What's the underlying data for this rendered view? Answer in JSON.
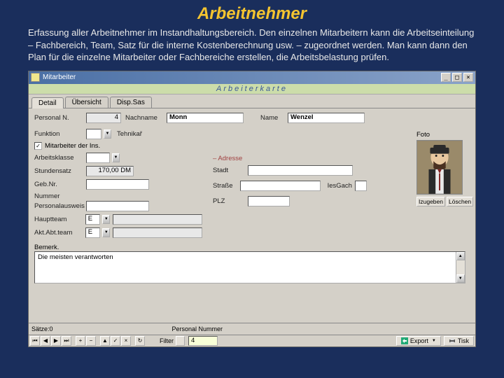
{
  "page": {
    "title": "Arbeitnehmer",
    "description": "Erfassung aller Arbeitnehmer im Instandhaltungsbereich. Den einzelnen Mitarbeitern kann die Arbeitseinteilung – Fachbereich, Team, Satz für die interne Kostenberechnung usw. – zugeordnet werden. Man kann dann den Plan für die einzelne Mitarbeiter oder Fachbereiche erstellen, die Arbeitsbelastung prüfen."
  },
  "window": {
    "title": "Mitarbeiter",
    "card_title": "Arbeiterkarte"
  },
  "tabs": [
    "Detail",
    "Übersicht",
    "Disp.Sas"
  ],
  "fields": {
    "personal_n_label": "Personal N.",
    "personal_n_value": "4",
    "nachname_label": "Nachname",
    "nachname_value": "Monn",
    "name_label": "Name",
    "name_value": "Wenzel",
    "funktion_label": "Funktion",
    "tehnikar_label": "Tehnikař",
    "mitarbeiter_cb_label": "Mitarbeiter der Ins.",
    "arbeitsklasse_label": "Arbeitsklasse",
    "stundensatz_label": "Stundensatz",
    "stundensatz_value": "170,00 DM",
    "gebnr_label": "Geb.Nr.",
    "nummer_label": "Nummer",
    "persausweis_label": "Personalausweis",
    "hauptteam_label": "Hauptteam",
    "hauptteam_value": "E",
    "aktabtteam_label": "Akt.Abt.team",
    "aktabtteam_value": "E",
    "adresse_head": "Adresse",
    "stadt_label": "Stadt",
    "strasse_label": "Straße",
    "iesgach_label": "IesGach",
    "plz_label": "PLZ",
    "foto_label": "Foto",
    "bemerk_label": "Bemerk."
  },
  "buttons": {
    "foto_add": "Izugeben",
    "foto_del": "Löschen",
    "filter_label": "Filter",
    "export": "Export",
    "print": "Tisk"
  },
  "textarea_value": "Die meisten verantworten",
  "status": {
    "saetze_label": "Sätze:",
    "saetze_value": "0",
    "pn_label": "Personal Nummer"
  },
  "nav_input": "4"
}
